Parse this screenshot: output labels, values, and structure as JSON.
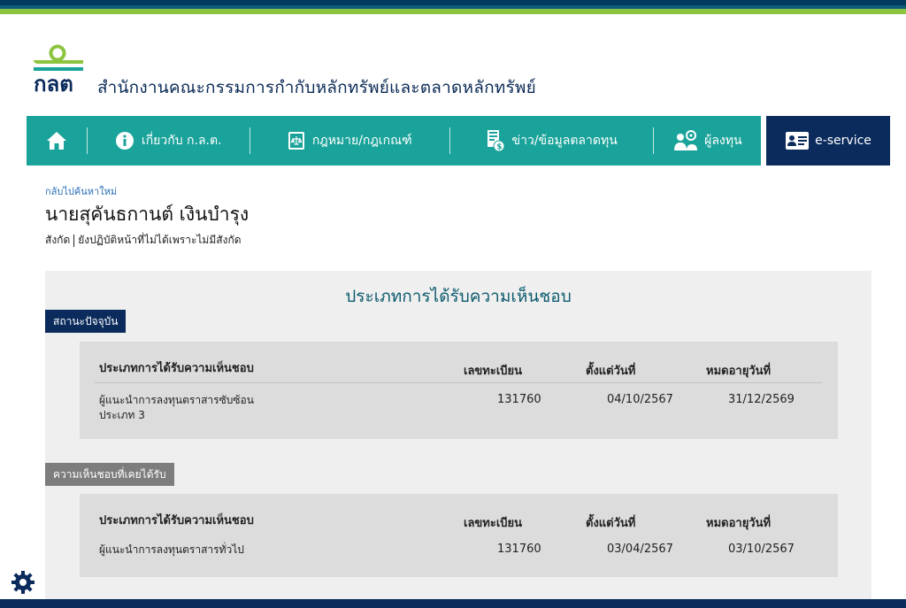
{
  "header": {
    "logo_text": "กลต",
    "org_name": "สำนักงานคณะกรรมการกำกับหลักทรัพย์และตลาดหลักทรัพย์"
  },
  "nav": {
    "home_icon": "home-icon",
    "items": [
      {
        "label": "เกี่ยวกับ ก.ล.ต.",
        "icon": "info-icon"
      },
      {
        "label": "กฎหมาย/กฎเกณฑ์",
        "icon": "law-book-icon"
      },
      {
        "label": "ข่าว/ข้อมูลตลาดทุน",
        "icon": "news-icon"
      },
      {
        "label": "ผู้ลงทุน",
        "icon": "investor-icon"
      }
    ],
    "eservice_label": "e-service",
    "colors": {
      "nav_bg": "#1aa39a",
      "eservice_bg": "#0a2b5c"
    }
  },
  "page": {
    "back_link": "กลับไปค้นหาใหม่",
    "person_name": "นายสุคันธกานต์ เงินบำรุง",
    "affiliation_label": "สังกัด",
    "affiliation_value": "ยังปฏิบัติหน้าที่ไม่ได้เพราะไม่มีสังกัด"
  },
  "panel": {
    "title": "ประเภทการได้รับความเห็นชอบ",
    "headers": {
      "type": "ประเภทการได้รับความเห็นชอบ",
      "reg_no": "เลขทะเบียน",
      "from": "ตั้งแต่วันที่",
      "to": "หมดอายุวันที่"
    },
    "current": {
      "label": "สถานะปัจจุบัน",
      "rows": [
        {
          "type": "ผู้แนะนำการลงทุนตราสารซับซ้อน ประเภท 3",
          "reg_no": "131760",
          "from": "04/10/2567",
          "to": "31/12/2569"
        }
      ]
    },
    "past": {
      "label": "ความเห็นชอบที่เคยได้รับ",
      "rows": [
        {
          "type": "ผู้แนะนำการลงทุนตราสารทั่วไป",
          "reg_no": "131760",
          "from": "03/04/2567",
          "to": "03/10/2567"
        }
      ]
    }
  },
  "widgets": {
    "settings_icon": "gear-icon"
  }
}
